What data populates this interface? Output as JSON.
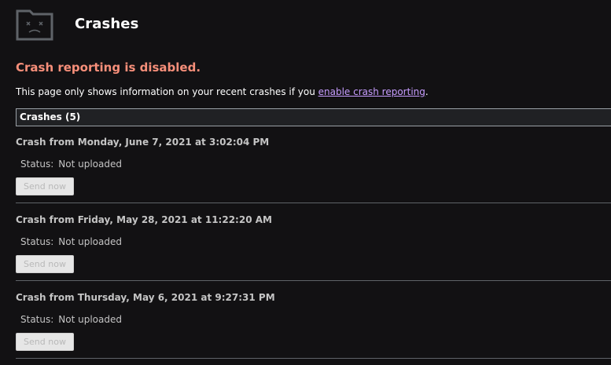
{
  "header": {
    "icon": "sad-folder-icon",
    "title": "Crashes"
  },
  "notice": {
    "heading": "Crash reporting is disabled.",
    "text_before": "This page only shows information on your recent crashes if you ",
    "link_text": "enable crash reporting",
    "text_after": "."
  },
  "section": {
    "header": "Crashes (5)"
  },
  "crashes": [
    {
      "title": "Crash from Monday, June 7, 2021 at 3:02:04 PM",
      "status_label": "Status:",
      "status_value": "Not uploaded",
      "button_label": "Send now"
    },
    {
      "title": "Crash from Friday, May 28, 2021 at 11:22:20 AM",
      "status_label": "Status:",
      "status_value": "Not uploaded",
      "button_label": "Send now"
    },
    {
      "title": "Crash from Thursday, May 6, 2021 at 9:27:31 PM",
      "status_label": "Status:",
      "status_value": "Not uploaded",
      "button_label": "Send now"
    }
  ],
  "colors": {
    "background": "#121113",
    "warning": "#f78f7a",
    "link": "#c79dff"
  }
}
